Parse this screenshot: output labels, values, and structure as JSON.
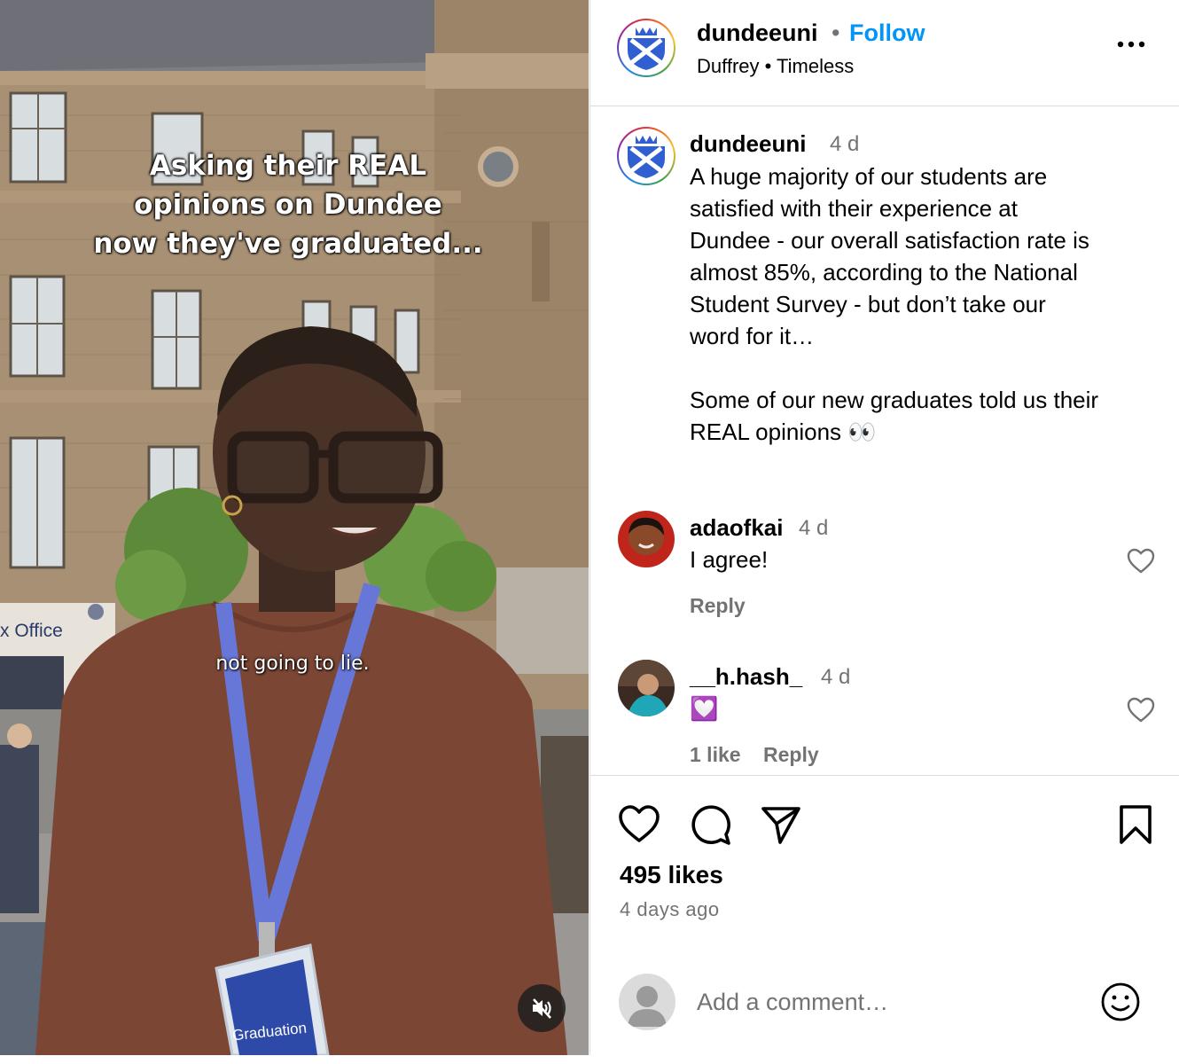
{
  "video": {
    "overlay_title": "Asking their REAL\nopinions on Dundee\nnow they've graduated...",
    "caption": "not going to lie.",
    "scene_sign": "x Office",
    "badge_text": "Graduation",
    "mute_icon": "muted-speaker-icon"
  },
  "header": {
    "username": "dundeeuni",
    "separator": "•",
    "follow_label": "Follow",
    "audio": "Duffrey • Timeless",
    "more_icon": "more-horizontal-icon"
  },
  "caption": {
    "username": "dundeeuni",
    "time": "4 d",
    "text": "A huge majority of our students are\nsatisfied with their experience at\nDundee - our overall satisfaction rate is\nalmost 85%, according to the National\nStudent Survey - but don’t take our\nword for it…\n\nSome of our new graduates told us their\nREAL opinions 👀"
  },
  "comments": [
    {
      "username": "adaofkai",
      "time": "4 d",
      "text": "I agree!",
      "reply_label": "Reply",
      "likes_label": ""
    },
    {
      "username": "__h.hash_",
      "time": "4 d",
      "text": "💟",
      "reply_label": "Reply",
      "likes_label": "1 like"
    }
  ],
  "actions": {
    "likes": "495 likes",
    "posted": "4 days ago",
    "icons": [
      "heart-icon",
      "comment-icon",
      "share-icon",
      "bookmark-icon"
    ]
  },
  "add_comment": {
    "placeholder": "Add a comment…",
    "emoji_icon": "smiley-icon"
  },
  "colors": {
    "accent": "#0095f6",
    "muted": "#737373",
    "border": "#dbdbdb",
    "brand_blue": "#2f5fd0"
  }
}
